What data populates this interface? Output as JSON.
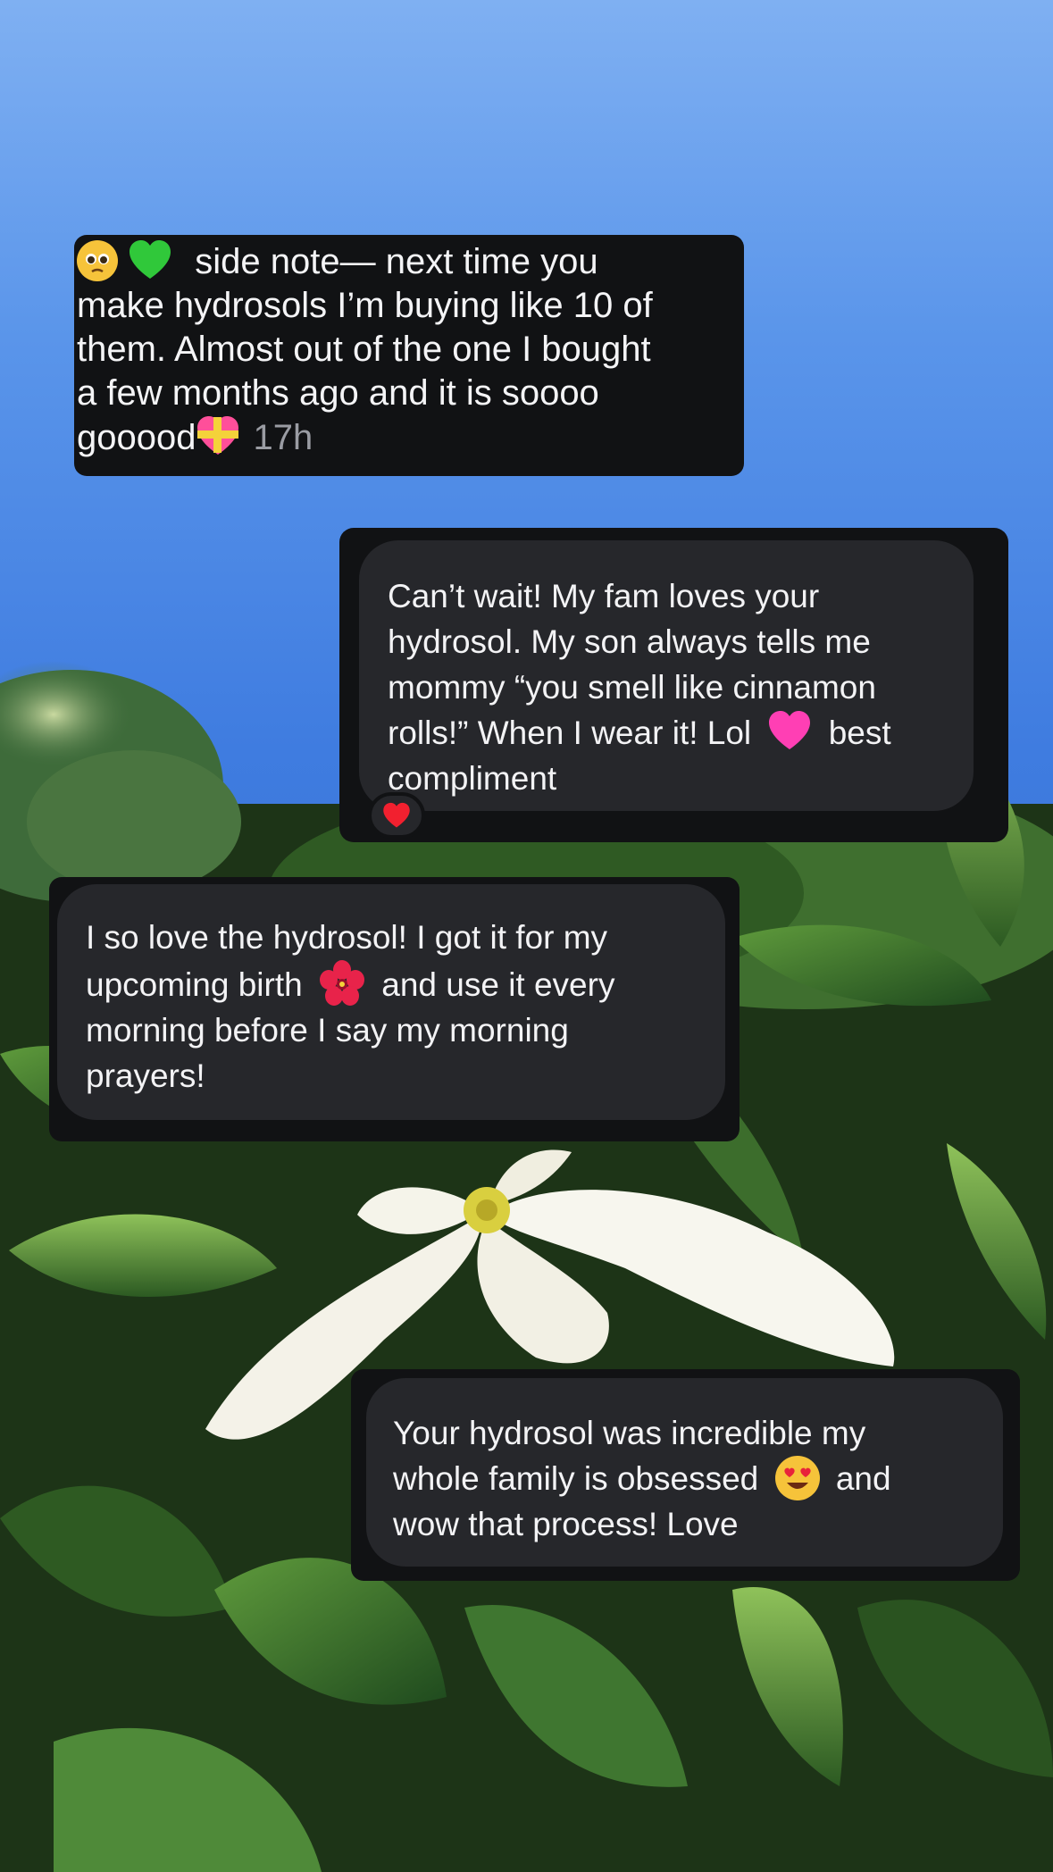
{
  "messages": [
    {
      "line1": "side note— next time you",
      "line2": "make hydrosols I’m buying like 10 of",
      "line3": "them. Almost out of the one I bought",
      "line4": "a few months ago and it is soooo",
      "line5": "gooood",
      "timestamp": "17h",
      "emojis": [
        "pleading-face-emoji",
        "green-heart-emoji",
        "heart-with-ribbon-emoji"
      ]
    },
    {
      "line1": "Can’t wait! My fam loves your",
      "line2": "hydrosol. My son always tells me",
      "line3": "mommy “you smell like cinnamon",
      "line4a": "rolls!” When I wear it! Lol",
      "line4b": "best",
      "line5": "compliment",
      "emojis": [
        "pink-heart-emoji"
      ],
      "reaction": "red-heart-emoji"
    },
    {
      "line1": "I so love the hydrosol! I got it for my",
      "line2a": "upcoming birth",
      "line2b": "and use it every",
      "line3": "morning before I say my morning",
      "line4": "prayers!",
      "emojis": [
        "hibiscus-emoji"
      ]
    },
    {
      "line1": "Your hydrosol was incredible my",
      "line2a": "whole family is obsessed",
      "line2b": "and",
      "line3": "wow that process! Love",
      "emojis": [
        "heart-eyes-emoji"
      ]
    }
  ],
  "colors": {
    "bubble": "#26272b",
    "screenshot_frame": "#111214",
    "text": "#f3f3f5",
    "timestamp": "#9a9ca3",
    "pink_heart": "#ff3fb4",
    "red_heart": "#f2202f",
    "green_heart": "#30c83a"
  }
}
